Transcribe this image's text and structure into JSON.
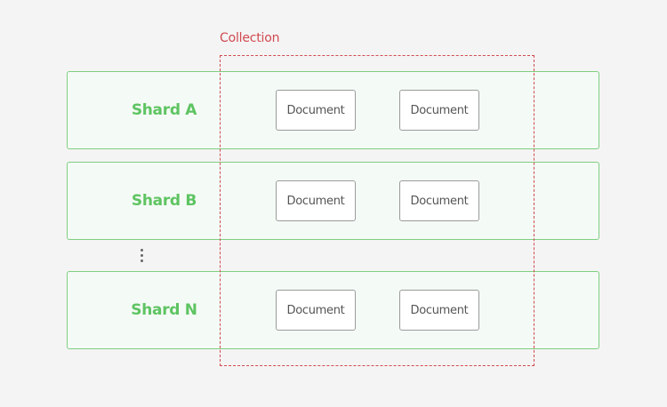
{
  "collection": {
    "label": "Collection",
    "color": "#d04a50"
  },
  "colors": {
    "shard_border": "#7fcf82",
    "shard_fill": "#f4faf5",
    "shard_text": "#5ec462",
    "document_border": "#9b9b9b",
    "background": "#f5f4f4"
  },
  "shards": [
    {
      "label": "Shard A",
      "documents": [
        "Document",
        "Document"
      ]
    },
    {
      "label": "Shard B",
      "documents": [
        "Document",
        "Document"
      ]
    },
    {
      "label": "Shard N",
      "documents": [
        "Document",
        "Document"
      ]
    }
  ],
  "ellipsis_icon": "vertical-ellipsis-icon"
}
